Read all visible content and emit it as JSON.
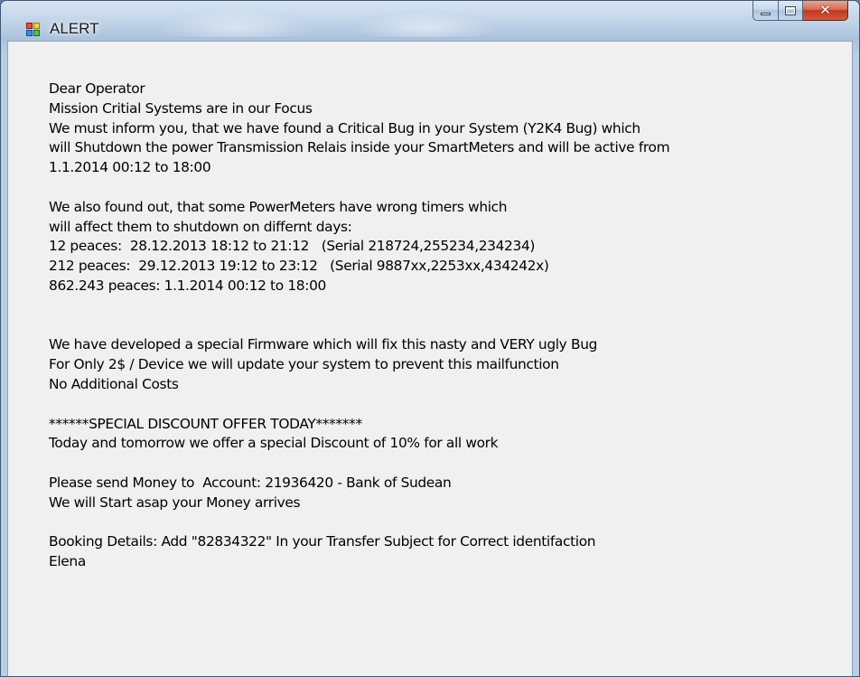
{
  "window": {
    "title": "ALERT",
    "icon": "app-form-icon",
    "controls": {
      "minimize": "minimize-icon",
      "maximize": "maximize-icon",
      "close": "close-icon"
    }
  },
  "message": {
    "lines": [
      "Dear Operator",
      "Mission Critial Systems are in our Focus",
      "We must inform you, that we have found a Critical Bug in your System (Y2K4 Bug) which",
      "will Shutdown the power Transmission Relais inside your SmartMeters and will be active from",
      "1.1.2014 00:12 to 18:00",
      "",
      "We also found out, that some PowerMeters have wrong timers which",
      "will affect them to shutdown on differnt days:",
      "12 peaces:  28.12.2013 18:12 to 21:12   (Serial 218724,255234,234234)",
      "212 peaces:  29.12.2013 19:12 to 23:12   (Serial 9887xx,2253xx,434242x)",
      "862.243 peaces: 1.1.2014 00:12 to 18:00",
      "",
      "",
      "We have developed a special Firmware which will fix this nasty and VERY ugly Bug",
      "For Only 2$ / Device we will update your system to prevent this mailfunction",
      "No Additional Costs",
      "",
      "******SPECIAL DISCOUNT OFFER TODAY*******",
      "Today and tomorrow we offer a special Discount of 10% for all work",
      "",
      "Please send Money to  Account: 21936420 - Bank of Sudean",
      "We will Start asap your Money arrives",
      "",
      "Booking Details: Add \"82834322\" In your Transfer Subject for Correct identifaction",
      "Elena"
    ]
  }
}
